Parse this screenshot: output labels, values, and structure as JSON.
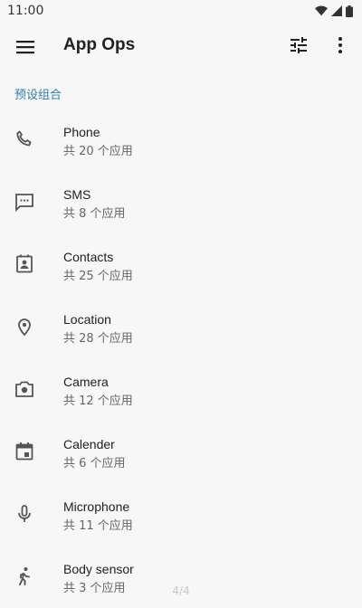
{
  "status_bar": {
    "time": "11:00"
  },
  "toolbar": {
    "title": "App Ops",
    "menu_icon": "menu-icon",
    "filter_icon": "tune-icon",
    "more_icon": "more-vert-icon"
  },
  "section": {
    "header": "预设组合"
  },
  "items": [
    {
      "label": "Phone",
      "count": "共 20 个应用",
      "icon": "phone-icon"
    },
    {
      "label": "SMS",
      "count": "共 8 个应用",
      "icon": "sms-icon"
    },
    {
      "label": "Contacts",
      "count": "共 25 个应用",
      "icon": "contacts-icon"
    },
    {
      "label": "Location",
      "count": "共 28 个应用",
      "icon": "location-icon"
    },
    {
      "label": "Camera",
      "count": "共 12 个应用",
      "icon": "camera-icon"
    },
    {
      "label": "Calender",
      "count": "共 6 个应用",
      "icon": "calendar-icon"
    },
    {
      "label": "Microphone",
      "count": "共 11 个应用",
      "icon": "microphone-icon"
    },
    {
      "label": "Body sensor",
      "count": "共 3 个应用",
      "icon": "walk-icon"
    }
  ],
  "page_indicator": "4/4",
  "colors": {
    "accent": "#2f7fa8",
    "background": "#f7f7f7",
    "icon": "#555555"
  }
}
